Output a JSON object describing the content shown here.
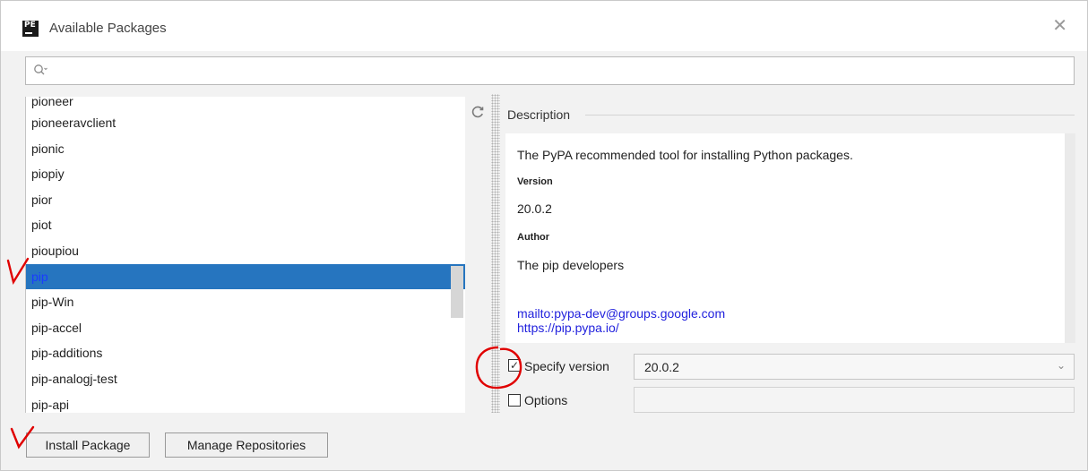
{
  "window": {
    "title": "Available Packages",
    "app_icon_text": "PE",
    "close_glyph": "✕"
  },
  "search": {
    "icon": "search-icon",
    "value": "",
    "placeholder": ""
  },
  "packages": {
    "items": [
      "pioneer",
      "pioneeravclient",
      "pionic",
      "piopiy",
      "pior",
      "piot",
      "pioupiou",
      "pip",
      "pip-Win",
      "pip-accel",
      "pip-additions",
      "pip-analogj-test",
      "pip-api"
    ],
    "selected": "pip",
    "refresh_icon": "refresh-icon"
  },
  "description": {
    "header": "Description",
    "summary": "The PyPA recommended tool for installing Python packages.",
    "version_label": "Version",
    "version_value": "20.0.2",
    "author_label": "Author",
    "author_value": "The pip developers",
    "email_link": "mailto:pypa-dev@groups.google.com",
    "home_link": "https://pip.pypa.io/"
  },
  "options": {
    "specify_version_label": "Specify version",
    "specify_version_checked": true,
    "version_selected": "20.0.2",
    "options_label": "Options",
    "options_checked": false,
    "options_value": ""
  },
  "buttons": {
    "install": "Install Package",
    "manage": "Manage Repositories"
  },
  "colors": {
    "selection": "#2675bf",
    "link": "#2222dd",
    "annotation": "#e00000"
  }
}
